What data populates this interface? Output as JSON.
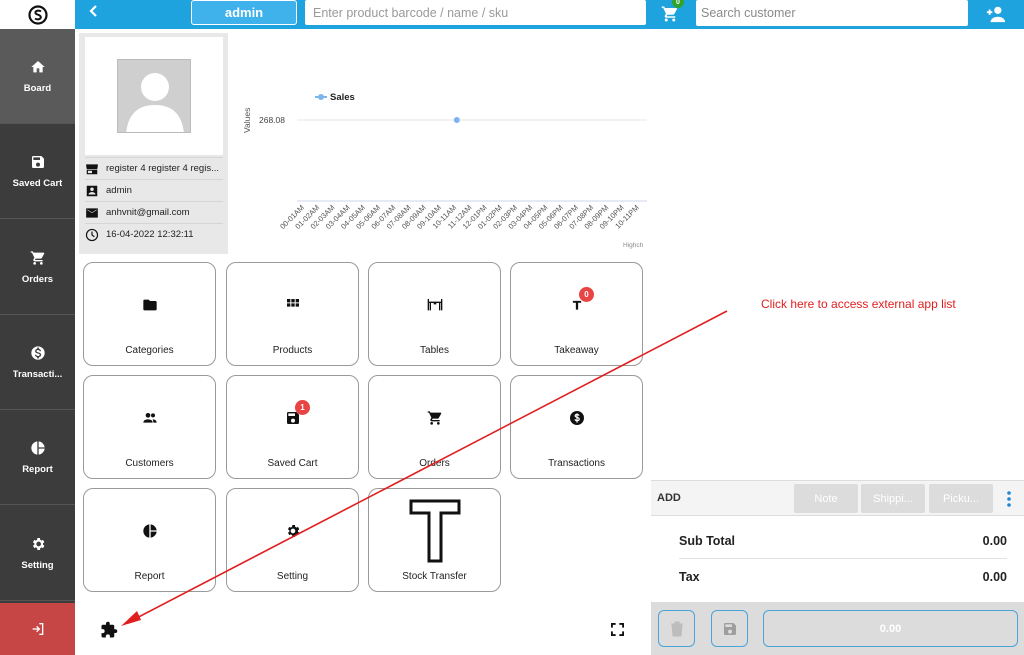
{
  "colors": {
    "topbar": "#1ea3df",
    "sidebar": "#3c3c3c",
    "logout": "#c64545",
    "badge": "#e84444",
    "annotation": "#e02020"
  },
  "sidebar": {
    "logo_icon": "brand-logo-icon",
    "items": [
      {
        "label": "Board",
        "icon": "home-icon"
      },
      {
        "label": "Saved Cart",
        "icon": "floppy-icon"
      },
      {
        "label": "Orders",
        "icon": "cart-icon"
      },
      {
        "label": "Transacti...",
        "icon": "dollar-icon"
      },
      {
        "label": "Report",
        "icon": "pie-chart-icon"
      },
      {
        "label": "Setting",
        "icon": "gear-icon"
      }
    ],
    "logout_icon": "logout-icon"
  },
  "topbar": {
    "back_icon": "chevron-left-icon",
    "user_label": "admin",
    "search_placeholder": "Enter product barcode / name / sku",
    "table_icon": "table-icon"
  },
  "profile": {
    "register": "register 4 register 4 regis...",
    "user": "admin",
    "email": "anhvnit@gmail.com",
    "datetime": "16-04-2022 12:32:11"
  },
  "chart_data": {
    "type": "line",
    "legend": [
      "Sales"
    ],
    "legend_position": "top-left",
    "ylabel": "Values",
    "ytick": "268.08",
    "series": [
      {
        "name": "Sales",
        "points": [
          {
            "x": "10-11AM",
            "y": 268.08
          }
        ]
      }
    ],
    "categories": [
      "00-01AM",
      "01-02AM",
      "02-03AM",
      "03-04AM",
      "04-05AM",
      "05-06AM",
      "06-07AM",
      "07-08AM",
      "08-09AM",
      "09-10AM",
      "10-11AM",
      "11-12AM",
      "12-01PM",
      "01-02PM",
      "02-03PM",
      "03-04PM",
      "04-05PM",
      "05-06PM",
      "06-07PM",
      "07-08PM",
      "08-09PM",
      "09-10PM",
      "10-11PM"
    ],
    "credit": "Highch"
  },
  "tiles": [
    {
      "label": "Categories",
      "icon": "folder-icon",
      "badge": null
    },
    {
      "label": "Products",
      "icon": "grid-icon",
      "badge": null
    },
    {
      "label": "Tables",
      "icon": "table-icon",
      "badge": null
    },
    {
      "label": "Takeaway",
      "icon": "takeaway-icon",
      "badge": "0"
    },
    {
      "label": "Customers",
      "icon": "users-icon",
      "badge": null
    },
    {
      "label": "Saved Cart",
      "icon": "floppy-icon",
      "badge": "1"
    },
    {
      "label": "Orders",
      "icon": "cart-icon",
      "badge": null
    },
    {
      "label": "Transactions",
      "icon": "dollar-icon",
      "badge": null
    },
    {
      "label": "Report",
      "icon": "pie-chart-icon",
      "badge": null
    },
    {
      "label": "Setting",
      "icon": "gear-icon",
      "badge": null
    },
    {
      "label": "Stock Transfer",
      "icon": "stock-transfer-icon",
      "badge": null
    }
  ],
  "bottom": {
    "apps_icon": "puzzle-icon",
    "fullscreen_icon": "fullscreen-icon"
  },
  "customer": {
    "cart_count": "0",
    "search_placeholder": "Search customer",
    "add_icon": "add-user-icon"
  },
  "cart_options": {
    "add_label": "ADD",
    "buttons": [
      "Note",
      "Shippi...",
      "Picku..."
    ],
    "more_icon": "more-vertical-icon"
  },
  "totals": {
    "rows": [
      {
        "label": "Sub Total",
        "value": "0.00"
      },
      {
        "label": "Tax",
        "value": "0.00"
      }
    ]
  },
  "actions": {
    "delete_icon": "trash-icon",
    "save_icon": "floppy-icon",
    "pay_amount": "0.00"
  },
  "annotation": {
    "text": "Click here to access external app list"
  }
}
